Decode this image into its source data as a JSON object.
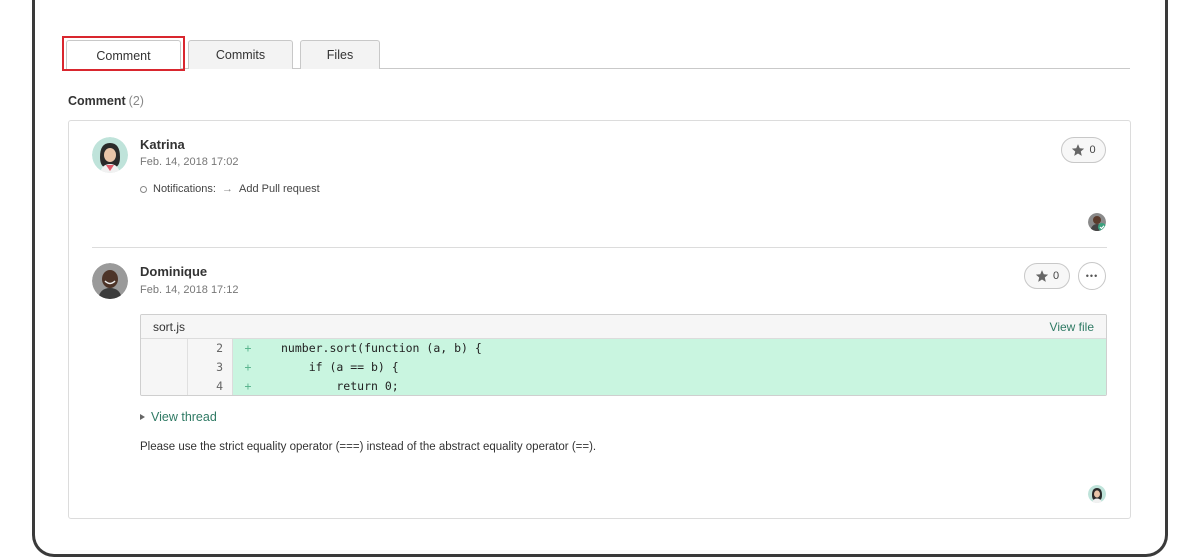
{
  "tabs": [
    {
      "label": "Comment",
      "active": true
    },
    {
      "label": "Commits",
      "active": false
    },
    {
      "label": "Files",
      "active": false
    }
  ],
  "section": {
    "title": "Comment",
    "count": "(2)"
  },
  "comments": [
    {
      "author": "Katrina",
      "timestamp": "Feb. 14, 2018 17:02",
      "notification_label": "Notifications:",
      "notification_action": "Add Pull request",
      "star_count": "0"
    },
    {
      "author": "Dominique",
      "timestamp": "Feb. 14, 2018 17:12",
      "star_count": "0",
      "more_label": "•••",
      "file_name": "sort.js",
      "view_file_label": "View file",
      "code_lines": [
        {
          "number": "2",
          "marker": "+",
          "text": "number.sort(function (a, b) {"
        },
        {
          "number": "3",
          "marker": "+",
          "text": "    if (a == b) {"
        },
        {
          "number": "4",
          "marker": "+",
          "text": "        return 0;"
        }
      ],
      "view_thread_label": "View thread",
      "body": "Please use the strict equality operator (===) instead of the abstract equality operator (==)."
    }
  ],
  "colors": {
    "accent": "#2f7a64",
    "added_line_bg": "#c9f5e0",
    "highlight_border": "#d9262e"
  }
}
